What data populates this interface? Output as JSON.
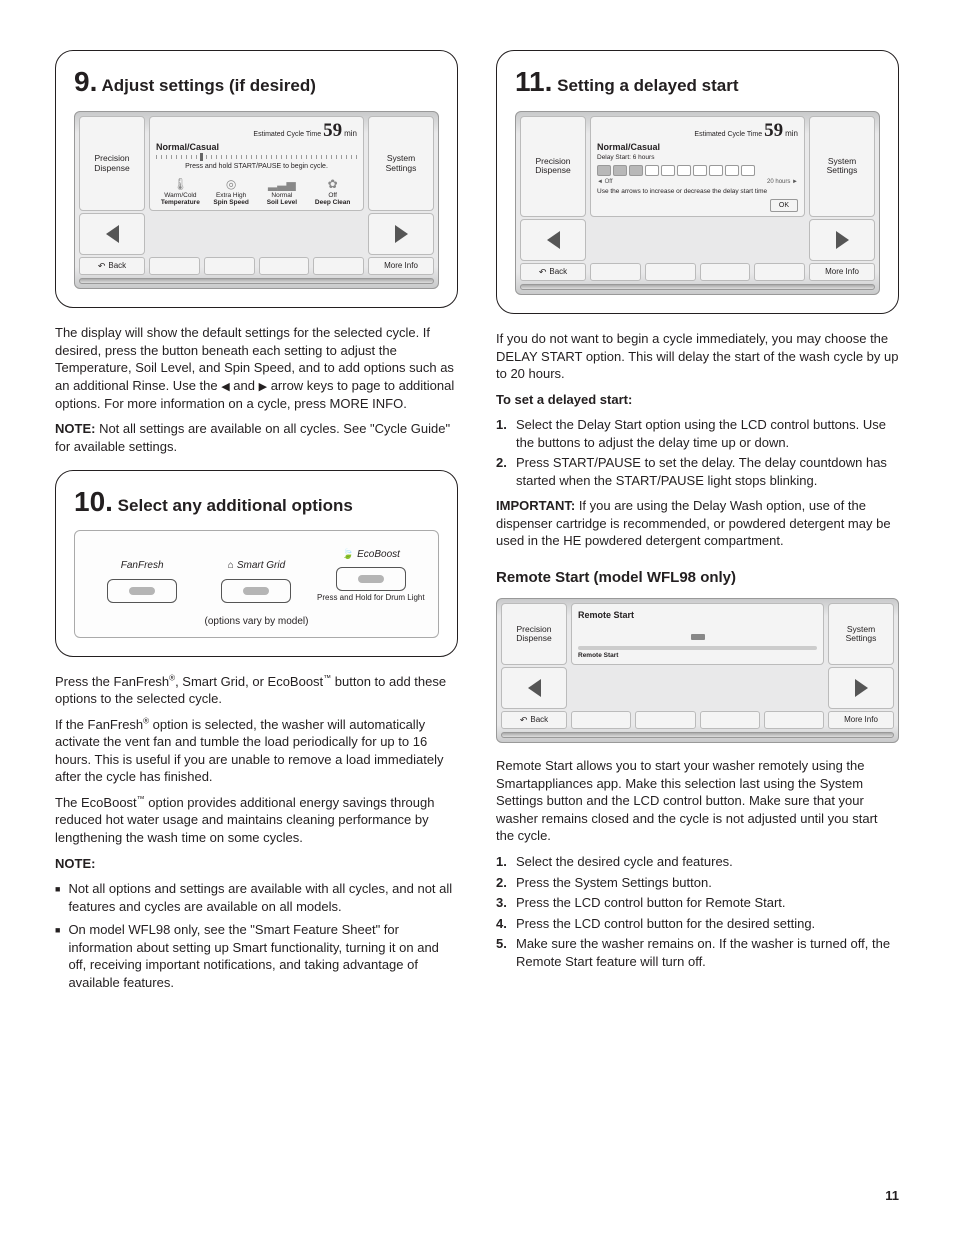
{
  "page_number": "11",
  "step9": {
    "num": "9.",
    "title": "Adjust settings (if desired)",
    "lcd": {
      "precision": "Precision Dispense",
      "system": "System Settings",
      "est_label": "Estimated Cycle Time",
      "est_value": "59",
      "est_unit": "min",
      "cycle": "Normal/Casual",
      "hint": "Press and hold START/PAUSE to begin cycle.",
      "s1a": "Warm/Cold",
      "s1b": "Temperature",
      "s2a": "Extra High",
      "s2b": "Spin Speed",
      "s3a": "Normal",
      "s3b": "Soil Level",
      "s4a": "Off",
      "s4b": "Deep Clean",
      "back": "Back",
      "more": "More Info"
    },
    "p1": "The display will show the default settings for the selected cycle. If desired, press the button beneath each setting to adjust the Temperature, Soil Level, and Spin Speed, and to add options such as an additional Rinse. Use the ",
    "p1b": " and ",
    "p1c": " arrow keys to page to additional options. For more information on a cycle, press MORE INFO.",
    "note_label": "NOTE:",
    "note": " Not all settings are available on all cycles. See \"Cycle Guide\" for available settings."
  },
  "step10": {
    "num": "10.",
    "title": "Select any additional options",
    "opts": {
      "o1": "FanFresh",
      "o2": "Smart Grid",
      "o3": "EcoBoost",
      "o3_sub": "Press and Hold for Drum Light",
      "vary": "(options vary by model)"
    },
    "p1a": "Press the FanFresh",
    "p1b": ", Smart Grid, or EcoBoost",
    "p1c": " button to add these options to the selected cycle.",
    "p2a": "If the FanFresh",
    "p2b": " option is selected, the washer will automatically activate the vent fan and tumble the load periodically for up to 16 hours. This is useful if you are unable to remove a load immediately after the cycle has finished.",
    "p3a": "The EcoBoost",
    "p3b": " option provides additional energy savings through reduced hot water usage and maintains cleaning performance by lengthening the wash time on some cycles.",
    "note_label": "NOTE:",
    "b1": "Not all options and settings are available with all cycles, and not all features and cycles are available on all models.",
    "b2": "On model WFL98 only, see the \"Smart Feature Sheet\" for information about setting up Smart functionality, turning it on and off, receiving important notifications, and taking advantage of available features."
  },
  "step11": {
    "num": "11.",
    "title": "Setting a delayed start",
    "lcd": {
      "precision": "Precision Dispense",
      "system": "System Settings",
      "est_label": "Estimated Cycle Time",
      "est_value": "59",
      "est_unit": "min",
      "cycle": "Normal/Casual",
      "delay_label": "Delay Start: 6 hours",
      "off": "◄ Off",
      "twenty": "20 hours ►",
      "hint": "Use the arrows to increase or decrease the delay start time",
      "ok": "OK",
      "back": "Back",
      "more": "More Info"
    },
    "p1": "If you do not want to begin a cycle immediately, you may choose the DELAY START option. This will delay the start of the wash cycle by up to 20 hours.",
    "set_label": "To set a delayed start:",
    "li1": "Select the Delay Start option using the LCD control buttons. Use the buttons to adjust the delay time up or down.",
    "li2": "Press START/PAUSE to set the delay. The delay countdown has started when the START/PAUSE light stops blinking.",
    "imp_label": "IMPORTANT:",
    "imp": " If you are using the Delay Wash option, use of the dispenser cartridge is recommended, or powdered detergent may be used in the HE powdered detergent compartment."
  },
  "remote": {
    "heading": "Remote Start (model WFL98 only)",
    "lcd": {
      "precision": "Precision Dispense",
      "system": "System Settings",
      "title": "Remote Start",
      "btn": "Remote Start",
      "back": "Back",
      "more": "More Info"
    },
    "p1": "Remote Start allows you to start your washer remotely using the Smartappliances app. Make this selection last using the System Settings button and the LCD control button. Make sure that your washer remains closed and the cycle is not adjusted until you start the cycle.",
    "li1": "Select the desired cycle and features.",
    "li2": "Press the System Settings button.",
    "li3": "Press the LCD control button for Remote Start.",
    "li4": "Press the LCD control button for the desired setting.",
    "li5": "Make sure the washer remains on. If the washer is turned off, the Remote Start feature will turn off."
  }
}
